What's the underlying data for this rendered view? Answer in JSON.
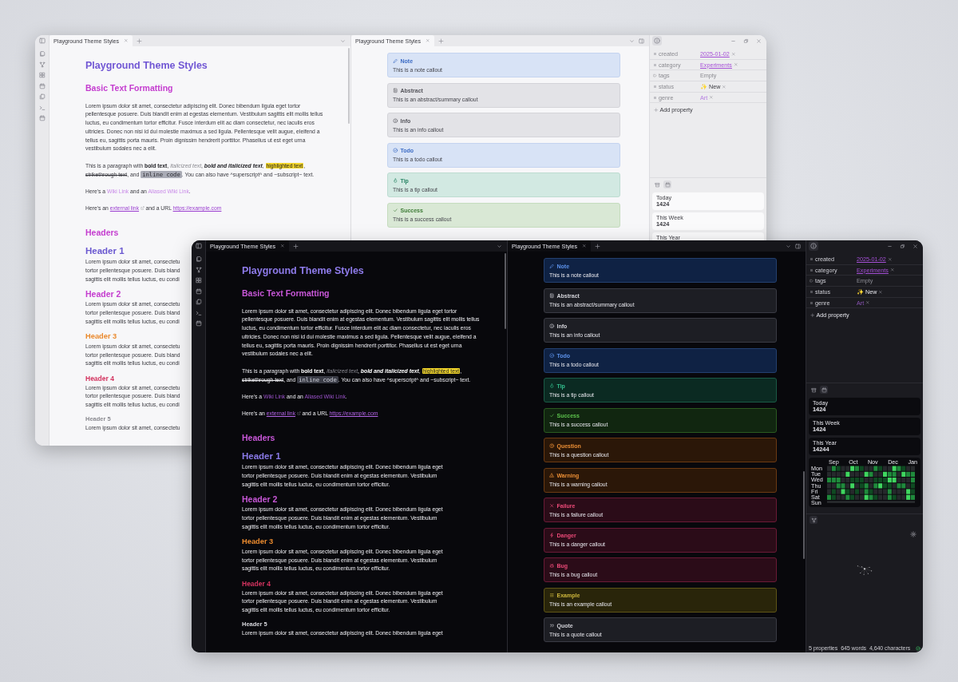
{
  "windows": [
    {
      "kind": "light",
      "left_tab": "Playground Theme Styles",
      "right_tab": "Playground Theme Styles",
      "doc": {
        "title": "Playground Theme Styles",
        "heading": "Basic Text Formatting",
        "paragraphs": [
          {
            "segments": [
              {
                "kind": "text",
                "text": "Lorem ipsum dolor sit amet, consectetur adipiscing elit. Donec bibendum ligula eget tortor pellentesque posuere. Duis blandit enim at egestas elementum. Vestibulum sagittis elit mollis tellus luctus, eu condimentum tortor efficitur. Fusce interdum elit ac diam consectetur, nec iaculis eros ultricies. Donec non nisi id dui molestie maximus a sed ligula. Pellentesque velit augue, eleifend a tellus eu, sagittis porta mauris. Proin dignissim hendrerit porttitor. Phasellus ut est eget urna vestibulum sodales nec a elit."
              }
            ]
          },
          {
            "segments": [
              {
                "kind": "text",
                "text": "This is a paragraph with "
              },
              {
                "kind": "bold",
                "text": "bold text"
              },
              {
                "kind": "text",
                "text": ", "
              },
              {
                "kind": "italic",
                "text": "italicized text"
              },
              {
                "kind": "text",
                "text": ", "
              },
              {
                "kind": "bolditalic",
                "text": "bold and italicized text"
              },
              {
                "kind": "text",
                "text": ", "
              },
              {
                "kind": "highlight",
                "text": "highlighted text"
              },
              {
                "kind": "text",
                "text": ", "
              },
              {
                "kind": "strike",
                "text": "strikethrough text"
              },
              {
                "kind": "text",
                "text": ", and "
              },
              {
                "kind": "code",
                "text": "inline code"
              },
              {
                "kind": "text",
                "text": ". You can also have ^superscript^ and ~subscript~ text."
              }
            ]
          },
          {
            "segments": [
              {
                "kind": "text",
                "text": "Here's a "
              },
              {
                "kind": "wiki",
                "text": "Wiki Link"
              },
              {
                "kind": "text",
                "text": " and an "
              },
              {
                "kind": "wiki",
                "text": "Aliased Wiki Link"
              },
              {
                "kind": "text",
                "text": "."
              }
            ]
          },
          {
            "segments": [
              {
                "kind": "text",
                "text": "Here's an "
              },
              {
                "kind": "external",
                "text": "external link"
              },
              {
                "kind": "text",
                "text": " and a URL "
              },
              {
                "kind": "url",
                "text": "https://example.com"
              }
            ]
          }
        ],
        "headers_heading": "Headers",
        "headers": [
          {
            "kind": "h1",
            "title": "Header 1",
            "lines": [
              "Lorem ipsum dolor sit amet, consectetu",
              "tortor pellentesque posuere. Duis bland",
              "sagittis elit mollis tellus luctus, eu condi"
            ]
          },
          {
            "kind": "h2",
            "title": "Header 2",
            "lines": [
              "Lorem ipsum dolor sit amet, consectetu",
              "tortor pellentesque posuere. Duis bland",
              "sagittis elit mollis tellus luctus, eu condi"
            ]
          },
          {
            "kind": "h3",
            "title": "Header 3",
            "lines": [
              "Lorem ipsum dolor sit amet, consectetu",
              "tortor pellentesque posuere. Duis bland",
              "sagittis elit mollis tellus luctus, eu condi"
            ]
          },
          {
            "kind": "h4",
            "title": "Header 4",
            "lines": [
              "Lorem ipsum dolor sit amet, consectetu",
              "tortor pellentesque posuere. Duis bland",
              "sagittis elit mollis tellus luctus, eu condi"
            ]
          },
          {
            "kind": "h5",
            "title": "Header 5",
            "lines": [
              "Lorem ipsum dolor sit amet, consectetu"
            ]
          }
        ]
      },
      "callouts": [
        {
          "kind": "note",
          "title": "Note",
          "body": "This is a note callout"
        },
        {
          "kind": "abstract",
          "title": "Abstract",
          "body": "This is an abstract/summary callout"
        },
        {
          "kind": "info",
          "title": "Info",
          "body": "This is an info callout"
        },
        {
          "kind": "todo",
          "title": "Todo",
          "body": "This is a todo callout"
        },
        {
          "kind": "tip",
          "title": "Tip",
          "body": "This is a tip callout"
        },
        {
          "kind": "success",
          "title": "Success",
          "body": "This is a success callout"
        }
      ],
      "properties": [
        {
          "key": "created",
          "kind": "link",
          "value": "2025-01-02",
          "is_list": false,
          "removable": true
        },
        {
          "key": "category",
          "kind": "link",
          "value": "Experiments",
          "is_list": false,
          "removable": true
        },
        {
          "key": "tags",
          "kind": "empty",
          "value": "Empty",
          "is_list": true,
          "removable": false
        },
        {
          "key": "status",
          "kind": "plain",
          "value": "✨ New",
          "is_list": false,
          "removable": true
        },
        {
          "key": "genre",
          "kind": "pill",
          "value": "Art",
          "is_list": false,
          "removable": true
        }
      ],
      "add_property": "Add property",
      "stat_tabs": [
        {
          "selected": false
        },
        {
          "selected": true
        }
      ],
      "stats": [
        {
          "label": "Today",
          "value": "1424"
        },
        {
          "label": "This Week",
          "value": "1424"
        },
        {
          "label": "This Year"
        }
      ]
    },
    {
      "kind": "dark",
      "left_tab": "Playground Theme Styles",
      "right_tab": "Playground Theme Styles",
      "doc": {
        "title": "Playground Theme Styles",
        "heading": "Basic Text Formatting",
        "paragraphs": [
          {
            "segments": [
              {
                "kind": "text",
                "text": "Lorem ipsum dolor sit amet, consectetur adipiscing elit. Donec bibendum ligula eget tortor pellentesque posuere. Duis blandit enim at egestas elementum. Vestibulum sagittis elit mollis tellus luctus, eu condimentum tortor efficitur. Fusce interdum elit ac diam consectetur, nec iaculis eros ultricies. Donec non nisi id dui molestie maximus a sed ligula. Pellentesque velit augue, eleifend a tellus eu, sagittis porta mauris. Proin dignissim hendrerit porttitor. Phasellus ut est eget urna vestibulum sodales nec a elit."
              }
            ]
          },
          {
            "segments": [
              {
                "kind": "text",
                "text": "This is a paragraph with "
              },
              {
                "kind": "bold",
                "text": "bold text"
              },
              {
                "kind": "text",
                "text": ", "
              },
              {
                "kind": "italic",
                "text": "italicized text"
              },
              {
                "kind": "text",
                "text": ", "
              },
              {
                "kind": "bolditalic",
                "text": "bold and italicized text"
              },
              {
                "kind": "text",
                "text": ", "
              },
              {
                "kind": "highlight",
                "text": "highlighted text"
              },
              {
                "kind": "text",
                "text": ", "
              },
              {
                "kind": "strike",
                "text": "strikethrough text"
              },
              {
                "kind": "text",
                "text": ", and "
              },
              {
                "kind": "code",
                "text": "inline code"
              },
              {
                "kind": "text",
                "text": ". You can also have ^superscript^ and ~subscript~ text."
              }
            ]
          },
          {
            "segments": [
              {
                "kind": "text",
                "text": "Here's a "
              },
              {
                "kind": "wiki",
                "text": "Wiki Link"
              },
              {
                "kind": "text",
                "text": " and an "
              },
              {
                "kind": "wiki",
                "text": "Aliased Wiki Link"
              },
              {
                "kind": "text",
                "text": "."
              }
            ]
          },
          {
            "segments": [
              {
                "kind": "text",
                "text": "Here's an "
              },
              {
                "kind": "external",
                "text": "external link"
              },
              {
                "kind": "text",
                "text": " and a URL "
              },
              {
                "kind": "url",
                "text": "https://example.com"
              }
            ]
          }
        ],
        "headers_heading": "Headers",
        "headers": [
          {
            "kind": "h1",
            "title": "Header 1",
            "lines": [
              "Lorem ipsum dolor sit amet, consectetur adipiscing elit. Donec bibendum ligula eget",
              "tortor pellentesque posuere. Duis blandit enim at egestas elementum. Vestibulum",
              "sagittis elit mollis tellus luctus, eu condimentum tortor efficitur."
            ]
          },
          {
            "kind": "h2",
            "title": "Header 2",
            "lines": [
              "Lorem ipsum dolor sit amet, consectetur adipiscing elit. Donec bibendum ligula eget",
              "tortor pellentesque posuere. Duis blandit enim at egestas elementum. Vestibulum",
              "sagittis elit mollis tellus luctus, eu condimentum tortor efficitur."
            ]
          },
          {
            "kind": "h3",
            "title": "Header 3",
            "lines": [
              "Lorem ipsum dolor sit amet, consectetur adipiscing elit. Donec bibendum ligula eget",
              "tortor pellentesque posuere. Duis blandit enim at egestas elementum. Vestibulum",
              "sagittis elit mollis tellus luctus, eu condimentum tortor efficitur."
            ]
          },
          {
            "kind": "h4",
            "title": "Header 4",
            "lines": [
              "Lorem ipsum dolor sit amet, consectetur adipiscing elit. Donec bibendum ligula eget",
              "tortor pellentesque posuere. Duis blandit enim at egestas elementum. Vestibulum",
              "sagittis elit mollis tellus luctus, eu condimentum tortor efficitur."
            ]
          },
          {
            "kind": "h5",
            "title": "Header 5",
            "lines": [
              "Lorem ipsum dolor sit amet, consectetur adipiscing elit. Donec bibendum ligula eget"
            ]
          }
        ]
      },
      "callouts": [
        {
          "kind": "note",
          "title": "Note",
          "body": "This is a note callout"
        },
        {
          "kind": "abstract",
          "title": "Abstract",
          "body": "This is an abstract/summary callout"
        },
        {
          "kind": "info",
          "title": "Info",
          "body": "This is an info callout"
        },
        {
          "kind": "todo",
          "title": "Todo",
          "body": "This is a todo callout"
        },
        {
          "kind": "tip",
          "title": "Tip",
          "body": "This is a tip callout"
        },
        {
          "kind": "success",
          "title": "Success",
          "body": "This is a success callout"
        },
        {
          "kind": "question",
          "title": "Question",
          "body": "This is a question callout"
        },
        {
          "kind": "warning",
          "title": "Warning",
          "body": "This is a warning callout"
        },
        {
          "kind": "failure",
          "title": "Failure",
          "body": "This is a failure callout"
        },
        {
          "kind": "danger",
          "title": "Danger",
          "body": "This is a danger callout"
        },
        {
          "kind": "bug",
          "title": "Bug",
          "body": "This is a bug callout"
        },
        {
          "kind": "example",
          "title": "Example",
          "body": "This is an example callout"
        },
        {
          "kind": "quote",
          "title": "Quote",
          "body": "This is a quote callout"
        }
      ],
      "properties": [
        {
          "key": "created",
          "kind": "link",
          "value": "2025-01-02",
          "is_list": false,
          "removable": true
        },
        {
          "key": "category",
          "kind": "link",
          "value": "Experiments",
          "is_list": false,
          "removable": true
        },
        {
          "key": "tags",
          "kind": "empty",
          "value": "Empty",
          "is_list": true,
          "removable": false
        },
        {
          "key": "status",
          "kind": "plain",
          "value": "✨ New",
          "is_list": false,
          "removable": true
        },
        {
          "key": "genre",
          "kind": "pill",
          "value": "Art",
          "is_list": false,
          "removable": true
        }
      ],
      "add_property": "Add property",
      "stat_tabs": [
        {
          "selected": false
        },
        {
          "selected": true
        }
      ],
      "stats": [
        {
          "label": "Today",
          "value": "1424"
        },
        {
          "label": "This Week",
          "value": "1424"
        },
        {
          "label": "This Year",
          "value": "14244"
        }
      ],
      "heatmap": {
        "months": [
          "Sep",
          "Oct",
          "Nov",
          "Dec",
          "Jan"
        ],
        "days": [
          "Mon",
          "Tue",
          "Wed",
          "Thu",
          "Fri",
          "Sat",
          "Sun"
        ]
      },
      "graph_tabs": [
        {
          "selected": true
        }
      ],
      "status_bar": [
        "5 properties",
        "645 words",
        "4,640 characters"
      ]
    }
  ]
}
